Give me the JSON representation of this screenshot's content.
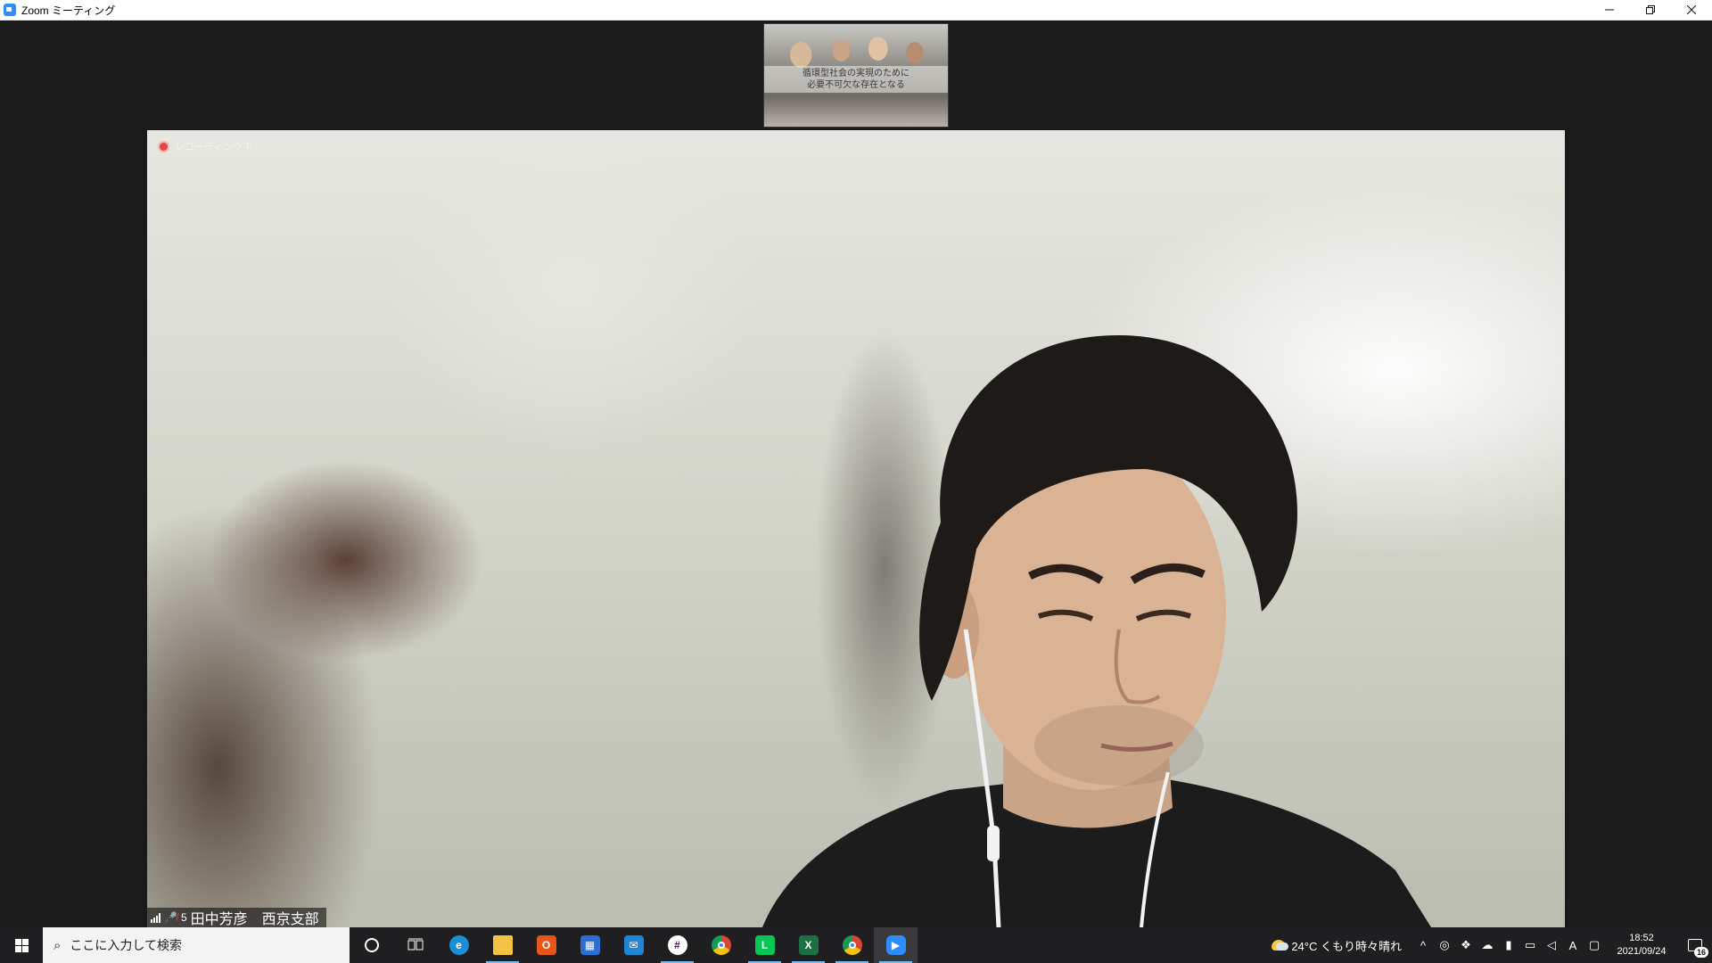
{
  "window": {
    "title": "Zoom ミーティング",
    "minimize_icon": "minimize-icon",
    "restore_icon": "restore-icon",
    "close_icon": "close-icon"
  },
  "thumbnail": {
    "caption_line1": "循環型社会の実現のために",
    "caption_line2": "必要不可欠な存在となる"
  },
  "main_video": {
    "recording_label": "レコーディング中",
    "participant_number": "5",
    "participant_name": "田中芳彦　西京支部",
    "muted": true
  },
  "taskbar": {
    "search_placeholder": "ここに入力して検索",
    "apps": [
      {
        "name": "cortana",
        "label": "O",
        "color": "#1f1f21"
      },
      {
        "name": "task-view",
        "label": "⊞",
        "color": "#1f1f21"
      },
      {
        "name": "edge",
        "label": "e",
        "color": "#1b8fd6"
      },
      {
        "name": "file-explorer",
        "label": "▭",
        "color": "#f3c243"
      },
      {
        "name": "office",
        "label": "O",
        "color": "#e8551b"
      },
      {
        "name": "store",
        "label": "▦",
        "color": "#2a6fd1"
      },
      {
        "name": "mail",
        "label": "✉",
        "color": "#1f85d5"
      },
      {
        "name": "slack",
        "label": "#",
        "color": "#ffffff"
      },
      {
        "name": "chrome",
        "label": "◉",
        "color": "#e9b43a"
      },
      {
        "name": "line",
        "label": "L",
        "color": "#06c755"
      },
      {
        "name": "excel",
        "label": "X",
        "color": "#1d7044"
      },
      {
        "name": "chrome-profile",
        "label": "◉",
        "color": "#d84a3a"
      },
      {
        "name": "zoom",
        "label": "▶",
        "color": "#2d8cff"
      }
    ],
    "weather": "24°C  くもり時々晴れ",
    "ime": "A",
    "time": "18:52",
    "date": "2021/09/24",
    "notification_count": "16"
  }
}
